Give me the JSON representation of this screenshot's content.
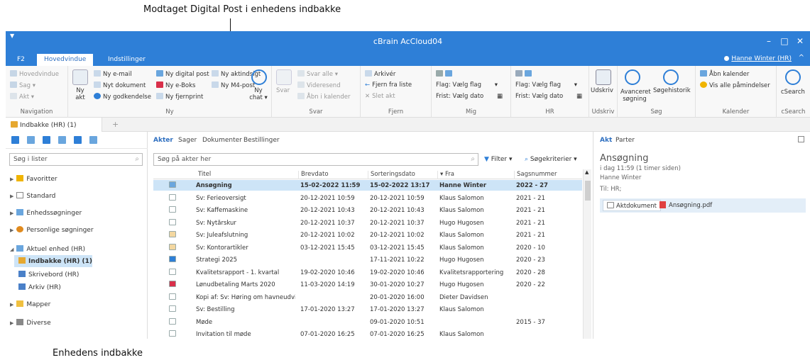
{
  "annotations": {
    "top": "Modtaget Digital Post i enhedens indbakke",
    "bottom": "Enhedens indbakke"
  },
  "window": {
    "title": "cBrain AcCloud04",
    "controls": [
      "–",
      "□",
      "✕"
    ]
  },
  "ribbon_tabs": {
    "f2": "F2",
    "main": "Hovedvindue",
    "settings": "Indstillinger"
  },
  "user": "Hanne Winter (HR)",
  "ribbon": {
    "navigation": {
      "label": "Navigation",
      "main": "Hovedvindue",
      "case": "Sag ▾",
      "act": "Akt ▾"
    },
    "ny": {
      "label": "Ny",
      "new_act": "Ny akt",
      "email": "Ny e-mail",
      "document": "Nyt dokument",
      "approval": "Ny godkendelse",
      "digital_post": "Ny digital post",
      "eboks": "Ny e-Boks",
      "remote_print": "Ny fjernprint",
      "act_step": "Ny aktindsigt",
      "m4_post": "Ny M4-post",
      "chat": "Ny chat ▾"
    },
    "svar": {
      "label": "Svar",
      "reply": "Svar",
      "reply_all": "Svar alle ▾",
      "forward": "Videresend",
      "open_calendar": "Åbn i kalender"
    },
    "fjern": {
      "label": "Fjern",
      "archive": "Arkivér",
      "remove_from_list": "Fjern fra liste",
      "delete_act": "Slet akt"
    },
    "mig": {
      "label": "Mig",
      "flag": "Flag:",
      "flag_value": "Vælg flag",
      "deadline": "Frist:",
      "deadline_value": "Vælg dato"
    },
    "hr": {
      "label": "HR",
      "flag": "Flag:",
      "flag_value": "Vælg flag",
      "deadline": "Frist:",
      "deadline_value": "Vælg dato"
    },
    "udskriv": {
      "label": "Udskriv",
      "print": "Udskriv"
    },
    "sog": {
      "label": "Søg",
      "advanced": "Avanceret søgning",
      "history": "Søgehistorik"
    },
    "kalender": {
      "label": "Kalender",
      "open": "Åbn kalender",
      "reminders": "Vis alle påmindelser"
    },
    "csearch": {
      "label": "cSearch",
      "button": "cSearch"
    }
  },
  "doc_tab": "Indbakke (HR) (1)",
  "left": {
    "search_placeholder": "Søg i lister",
    "tree": [
      {
        "label": "Favoritter",
        "arrow": "▶",
        "color": "#f0b400"
      },
      {
        "label": "Standard",
        "arrow": "▶",
        "color": "#888888"
      },
      {
        "label": "Enhedssøgninger",
        "arrow": "▶",
        "color": "#6a9fd4"
      },
      {
        "label": "Personlige søgninger",
        "arrow": "▶",
        "color": "#e08a1e"
      },
      {
        "label": "Aktuel enhed (HR)",
        "arrow": "◢",
        "color": "#6a9fd4"
      }
    ],
    "unit_items": [
      {
        "label": "Indbakke (HR) (1)",
        "color": "#e6a830",
        "selected": true
      },
      {
        "label": "Skrivebord (HR)",
        "color": "#4a80c8",
        "selected": false
      },
      {
        "label": "Arkiv (HR)",
        "color": "#4a80c8",
        "selected": false
      }
    ],
    "tree2": [
      {
        "label": "Mapper",
        "arrow": "▶",
        "color": "#f0c040"
      },
      {
        "label": "Diverse",
        "arrow": "▶",
        "color": "#888888"
      }
    ]
  },
  "center": {
    "tabs": [
      "Akter",
      "Sager",
      "Dokumenter",
      "Bestillinger"
    ],
    "search_placeholder": "Søg på akter her",
    "filter": "Filter ▾",
    "criteria": "Søgekriterier ▾",
    "columns": [
      "Titel",
      "Brevdato",
      "Sorteringsdato",
      "▾ Fra",
      "Sagsnummer"
    ],
    "rows": [
      {
        "title": "Ansøgning",
        "letter_date": "15-02-2022 11:59",
        "sort_date": "15-02-2022 13:17",
        "from": "Hanne Winter",
        "case": "2022 - 27",
        "icon": "#6aa6de",
        "selected": true
      },
      {
        "title": "Sv: Ferieoversigt",
        "letter_date": "20-12-2021 10:59",
        "sort_date": "20-12-2021 10:59",
        "from": "Klaus Salomon",
        "case": "2021 - 21",
        "icon": "#ffffff",
        "selected": false
      },
      {
        "title": "Sv: Kaffemaskine",
        "letter_date": "20-12-2021 10:43",
        "sort_date": "20-12-2021 10:43",
        "from": "Klaus Salomon",
        "case": "2021 - 21",
        "icon": "#ffffff",
        "selected": false
      },
      {
        "title": "Sv: Nytårskur",
        "letter_date": "20-12-2021 10:37",
        "sort_date": "20-12-2021 10:37",
        "from": "Hugo Hugosen",
        "case": "2021 - 21",
        "icon": "#ffffff",
        "selected": false
      },
      {
        "title": "Sv: Juleafslutning",
        "letter_date": "20-12-2021 10:02",
        "sort_date": "20-12-2021 10:02",
        "from": "Klaus Salomon",
        "case": "2021 - 21",
        "icon": "#f3d7a0",
        "selected": false
      },
      {
        "title": "Sv: Kontorartikler",
        "letter_date": "03-12-2021 15:45",
        "sort_date": "03-12-2021 15:45",
        "from": "Klaus Salomon",
        "case": "2020 - 10",
        "icon": "#f3d7a0",
        "selected": false
      },
      {
        "title": "Strategi 2025",
        "letter_date": "",
        "sort_date": "17-11-2021 10:22",
        "from": "Hugo Hugosen",
        "case": "2020 - 23",
        "icon": "#2e7fd7",
        "selected": false
      },
      {
        "title": "Kvalitetsrapport - 1. kvartal",
        "letter_date": "19-02-2020 10:46",
        "sort_date": "19-02-2020 10:46",
        "from": "Kvalitetsrapportering",
        "case": "2020 - 28",
        "icon": "#ffffff",
        "selected": false
      },
      {
        "title": "Lønudbetaling Marts 2020",
        "letter_date": "11-03-2020 14:19",
        "sort_date": "30-01-2020 10:27",
        "from": "Hugo Hugosen",
        "case": "2020 - 22",
        "icon": "#d9304a",
        "selected": false
      },
      {
        "title": "Kopi af: Sv: Høring om havneudvid...",
        "letter_date": "",
        "sort_date": "20-01-2020 16:00",
        "from": "Dieter Davidsen",
        "case": "",
        "icon": "#ffffff",
        "selected": false
      },
      {
        "title": "Sv: Bestilling",
        "letter_date": "17-01-2020 13:27",
        "sort_date": "17-01-2020 13:27",
        "from": "Klaus Salomon",
        "case": "",
        "icon": "#ffffff",
        "selected": false
      },
      {
        "title": "Møde",
        "letter_date": "",
        "sort_date": "09-01-2020 10:51",
        "from": "",
        "case": "2015 - 37",
        "icon": "#ffffff",
        "selected": false
      },
      {
        "title": "Invitation til møde",
        "letter_date": "07-01-2020 16:25",
        "sort_date": "07-01-2020 16:25",
        "from": "Klaus Salomon",
        "case": "",
        "icon": "#ffffff",
        "selected": false
      }
    ]
  },
  "right": {
    "tabs": [
      "Akt",
      "Parter"
    ],
    "title": "Ansøgning",
    "time": "i dag 11:59 (1 timer siden)",
    "sender": "Hanne Winter",
    "to": "Til:  HR;",
    "akt_document": "Aktdokument",
    "attachment": "Ansøgning.pdf"
  },
  "colors": {
    "accent": "#2e7fd7",
    "selection": "#cde4f7"
  }
}
